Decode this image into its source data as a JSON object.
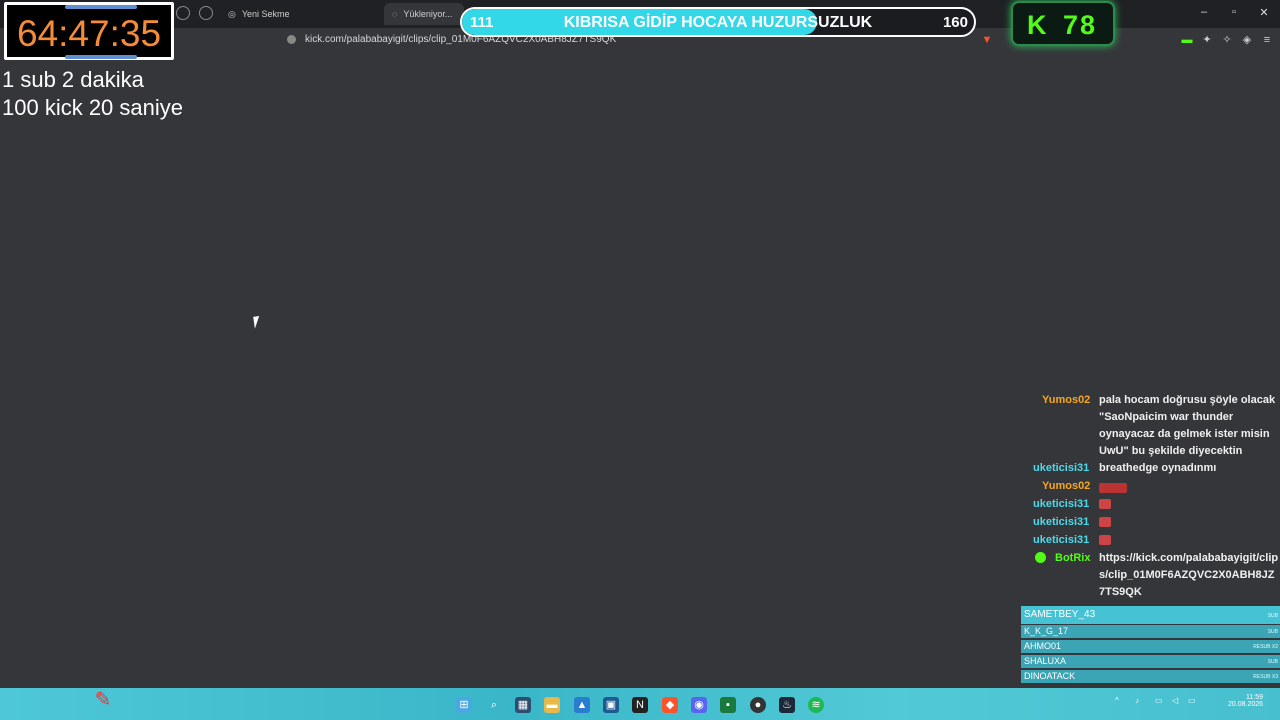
{
  "browser": {
    "tabs": [
      {
        "label": "Yeni Sekme"
      },
      {
        "label": "Yükleniyor..."
      }
    ],
    "url": "kick.com/palababayigit/clips/clip_01M0F6AZQVC2X0ABH8JZ7TS9QK"
  },
  "overlay": {
    "timer": "64:47:35",
    "rules": [
      "1 sub 2 dakika",
      "100 kick 20 saniye"
    ],
    "goal": {
      "current": "111",
      "title": "KIBRISA GİDİP HOCAYA HUZURSUZLUK",
      "target": "160",
      "progress": 0.694,
      "fill_color": "#33d8e8"
    },
    "kick_counter": {
      "logo": "K",
      "value": "78",
      "color": "#53fc18"
    }
  },
  "chat": {
    "messages": [
      {
        "user": "Yumos02",
        "color": "#f5a623",
        "text": "pala hocam doğrusu şöyle olacak \"SaoNpaicim war thunder oynayacaz da gelmek ister misin UwU\" bu şekilde diyecektin"
      },
      {
        "user": "uketicisi31",
        "color": "#4dd9e8",
        "text": "breathedge oynadınmı"
      },
      {
        "user": "Yumos02",
        "color": "#f5a623",
        "text": ""
      },
      {
        "user": "uketicisi31",
        "color": "#4dd9e8",
        "text": ""
      },
      {
        "user": "uketicisi31",
        "color": "#4dd9e8",
        "text": ""
      },
      {
        "user": "uketicisi31",
        "color": "#4dd9e8",
        "text": ""
      },
      {
        "user": "BotRix",
        "color": "#53fc18",
        "text": "https://kick.com/palababayigit/clips/clip_01M0F6AZQVC2X0ABH8JZ7TS9QK"
      }
    ]
  },
  "subfeed": {
    "rows": [
      {
        "name": "SAMETBEY_43",
        "tag": "SUB"
      },
      {
        "name": "K_K_G_17",
        "tag": "SUB"
      },
      {
        "name": "AHMO01",
        "tag": "RESUB X2"
      },
      {
        "name": "SHALUXA",
        "tag": "SUB"
      },
      {
        "name": "DINOATACK",
        "tag": "RESUB X3"
      }
    ]
  },
  "taskbar": {
    "clock_time": "11:59",
    "clock_date": "20.08.2026"
  }
}
